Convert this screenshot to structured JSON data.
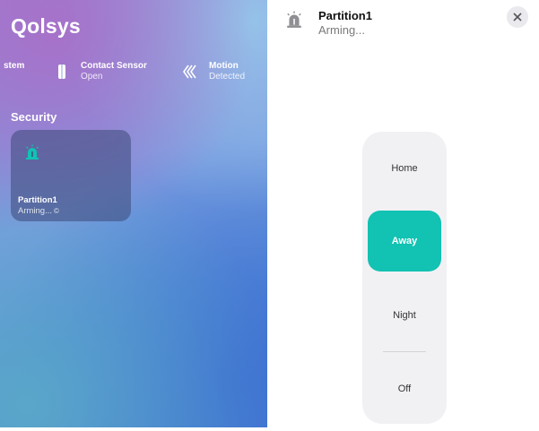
{
  "home": {
    "title": "Qolsys",
    "accessories": [
      {
        "name": "stem",
        "state": ""
      },
      {
        "name": "Contact Sensor",
        "state": "Open"
      },
      {
        "name": "Motion",
        "state": "Detected"
      }
    ],
    "section": "Security",
    "tile": {
      "name": "Partition1",
      "state": "Arming...",
      "spinner": "©"
    }
  },
  "detail": {
    "title": "Partition1",
    "status": "Arming...",
    "modes": [
      "Home",
      "Away",
      "Night",
      "Off"
    ],
    "selected_mode": "Away"
  },
  "colors": {
    "accent": "#12c2b2"
  }
}
